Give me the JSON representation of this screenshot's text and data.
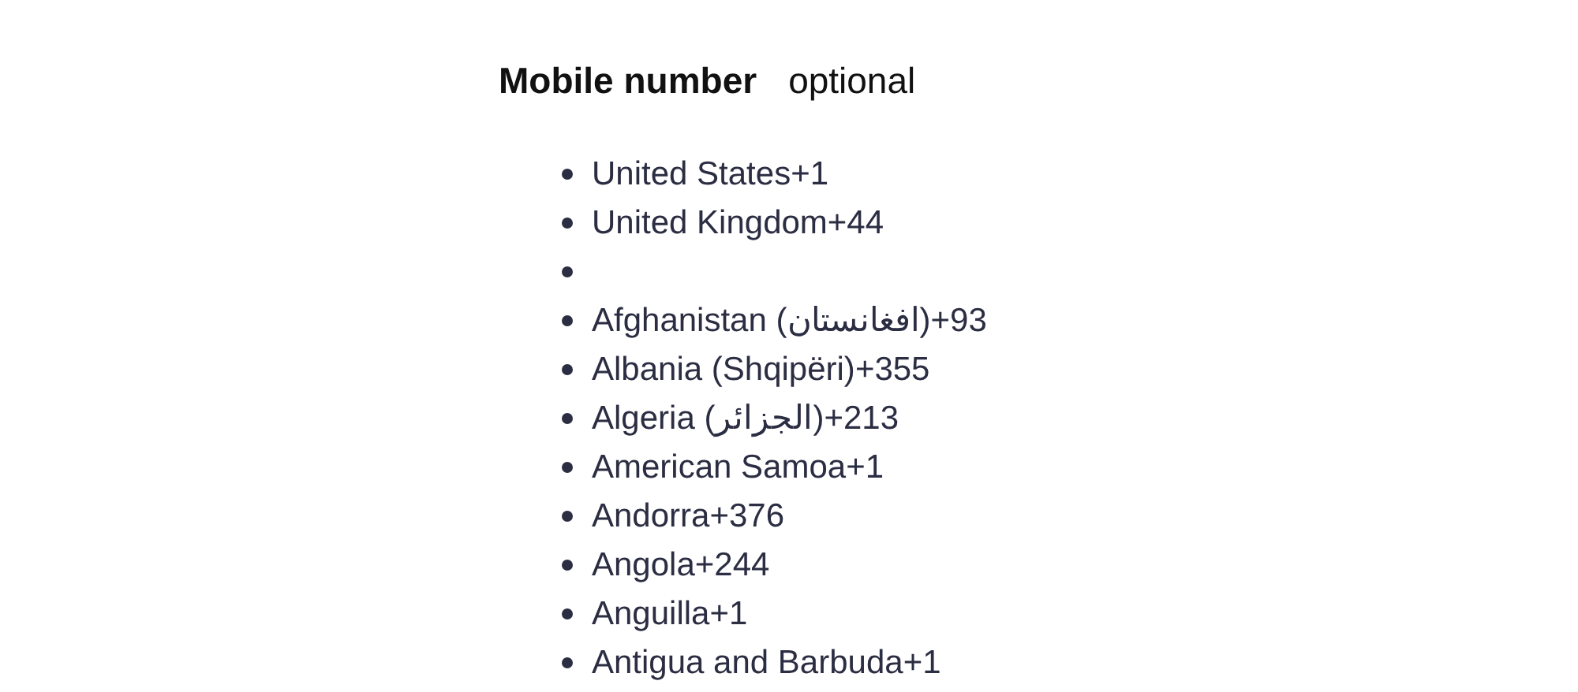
{
  "field": {
    "label": "Mobile number",
    "hint": "optional"
  },
  "countries": [
    {
      "kind": "country",
      "name": "United States",
      "code": "+1"
    },
    {
      "kind": "country",
      "name": "United Kingdom",
      "code": "+44"
    },
    {
      "kind": "separator"
    },
    {
      "kind": "country",
      "name": "Afghanistan (افغانستان)",
      "code": "+93"
    },
    {
      "kind": "country",
      "name": "Albania (Shqipëri)",
      "code": "+355"
    },
    {
      "kind": "country",
      "name": "Algeria (الجزائر)",
      "code": "+213"
    },
    {
      "kind": "country",
      "name": "American Samoa",
      "code": "+1"
    },
    {
      "kind": "country",
      "name": "Andorra",
      "code": "+376"
    },
    {
      "kind": "country",
      "name": "Angola",
      "code": "+244"
    },
    {
      "kind": "country",
      "name": "Anguilla",
      "code": "+1"
    },
    {
      "kind": "country",
      "name": "Antigua and Barbuda",
      "code": "+1"
    }
  ]
}
